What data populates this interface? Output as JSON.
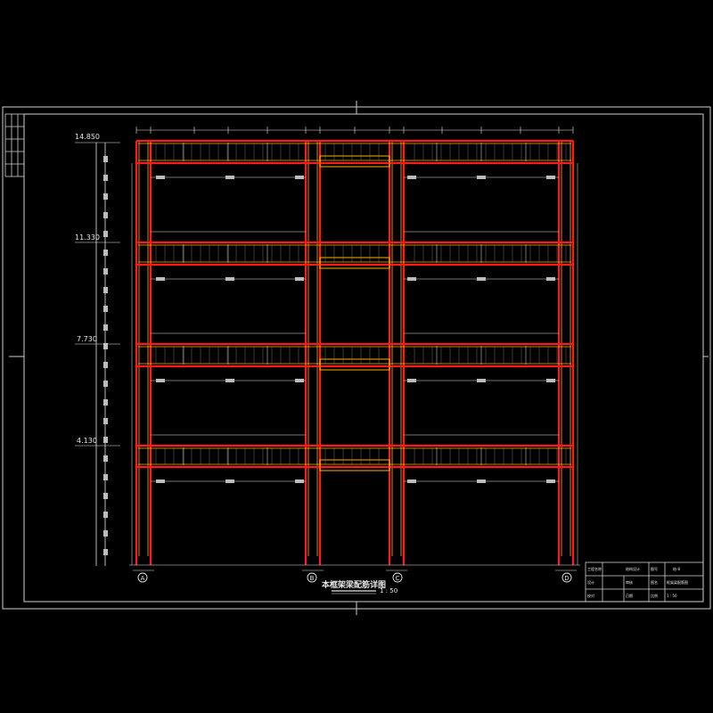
{
  "drawing": {
    "title": "本框架梁配筋详图",
    "scale": "1 : 50",
    "elevations": [
      "14.850",
      "11.330",
      "7.730",
      "4.130"
    ],
    "axes": [
      "A",
      "B",
      "C",
      "D"
    ],
    "colors": {
      "background": "#000000",
      "beam": "#ff1a1a",
      "rebar": "#ffb000",
      "dimension": "#e6e6e6",
      "frame": "#cfcfcf"
    }
  },
  "title_block": {
    "r1": [
      "工程名称",
      "结构设计",
      "图号",
      "结-8"
    ],
    "r2": [
      "设计",
      "审核",
      "图名",
      "框架梁配筋图"
    ],
    "r3": [
      "校对",
      "日期",
      "比例",
      "1 : 50"
    ]
  }
}
